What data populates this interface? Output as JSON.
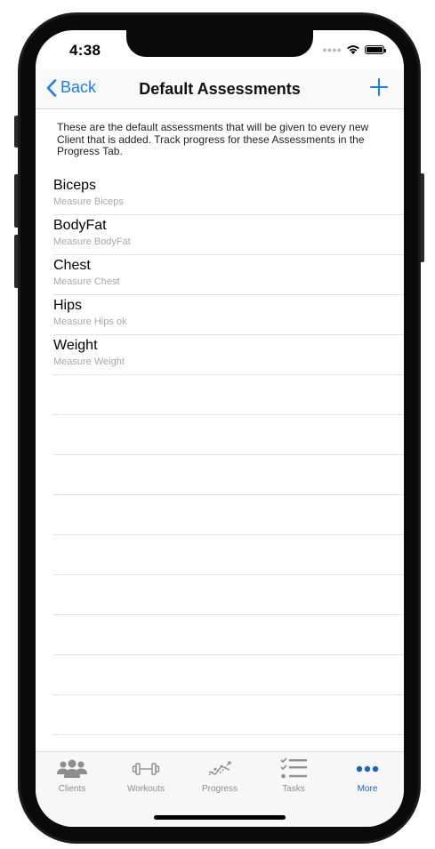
{
  "status": {
    "time": "4:38"
  },
  "nav": {
    "back_label": "Back",
    "title": "Default Assessments"
  },
  "description": "These are the default assessments that will be given to every new Client that is added.  Track progress for these Assessments in the Progress Tab.",
  "assessments": [
    {
      "title": "Biceps",
      "subtitle": "Measure Biceps"
    },
    {
      "title": "BodyFat",
      "subtitle": "Measure BodyFat"
    },
    {
      "title": "Chest",
      "subtitle": "Measure Chest"
    },
    {
      "title": "Hips",
      "subtitle": "Measure Hips ok"
    },
    {
      "title": "Weight",
      "subtitle": "Measure Weight"
    }
  ],
  "tabs": [
    {
      "label": "Clients",
      "icon": "people-icon"
    },
    {
      "label": "Workouts",
      "icon": "dumbbell-icon"
    },
    {
      "label": "Progress",
      "icon": "chart-icon"
    },
    {
      "label": "Tasks",
      "icon": "checklist-icon"
    },
    {
      "label": "More",
      "icon": "more-icon"
    }
  ],
  "active_tab": "More",
  "colors": {
    "accent": "#1a7ef2",
    "active_tab": "#1a63b8",
    "inactive_tab": "#8e8e8e"
  }
}
